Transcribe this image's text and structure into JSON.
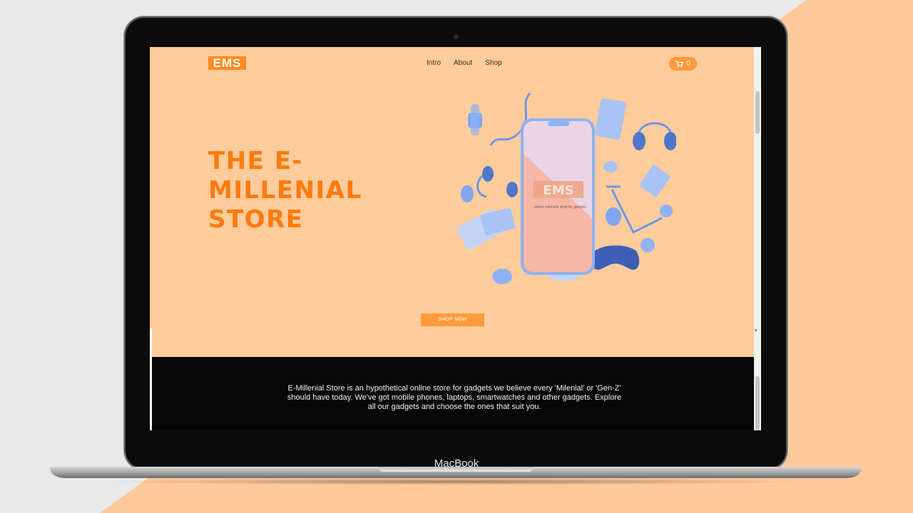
{
  "site": {
    "logo": "EMS",
    "nav": [
      {
        "label": "Intro"
      },
      {
        "label": "About"
      },
      {
        "label": "Shop"
      }
    ],
    "cart_count": "0",
    "hero_title": "THE E-MILLENIAL STORE",
    "phone_logo": "EMS",
    "phone_tagline": "..where milenials shop for gadgets",
    "shop_button": "SHOP NOW",
    "about_text": "E-Millenial Store is an hypothetical online store for gadgets we believe every 'Milenial' or 'Gen-Z' should have today. We've got mobile phones, laptops, smartwatches and other gadgets. Explore all our gadgets and choose the ones that suit you."
  },
  "device": {
    "brand": "MacBook"
  },
  "colors": {
    "accent": "#ff7a0d",
    "button": "#ff9a3c",
    "hero_bg": "#ffcc9c",
    "dark": "#070707",
    "illustration": "#8fb2f2"
  },
  "icons": [
    "cart-icon"
  ]
}
